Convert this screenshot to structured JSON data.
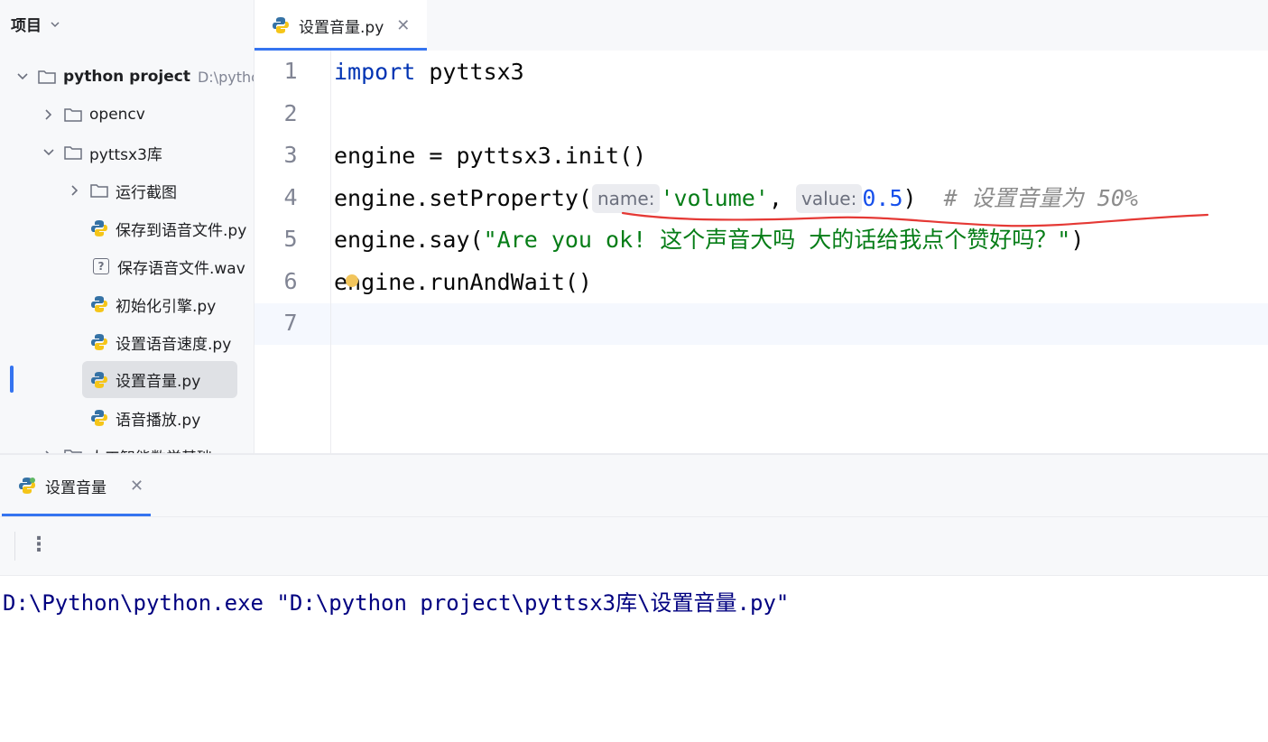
{
  "sidebar": {
    "header_label": "项目",
    "tree": {
      "root_name": "python project",
      "root_path": "D:\\python",
      "items": [
        {
          "label": "opencv"
        },
        {
          "label": "pyttsx3库"
        },
        {
          "label": "运行截图"
        },
        {
          "label": "保存到语音文件.py"
        },
        {
          "label": "保存语音文件.wav"
        },
        {
          "label": "初始化引擎.py"
        },
        {
          "label": "设置语音速度.py"
        },
        {
          "label": "设置音量.py"
        },
        {
          "label": "语音播放.py"
        },
        {
          "label": "人工智能数学基础"
        }
      ]
    }
  },
  "editor": {
    "tab_label": "设置音量.py",
    "line_numbers": [
      "1",
      "2",
      "3",
      "4",
      "5",
      "6",
      "7"
    ],
    "code": {
      "l1_kw": "import",
      "l1_rest": " pyttsx3",
      "l3": "engine = pyttsx3.init()",
      "l4_prefix": "engine.setProperty(",
      "l4_hint_name": "name:",
      "l4_str": "'volume'",
      "l4_comma": ", ",
      "l4_hint_value": "value:",
      "l4_num": "0.5",
      "l4_close": ")",
      "l4_comment": "  # 设置音量为 50%",
      "l5_prefix": "engine.say(",
      "l5_str": "\"Are you ok! 这个声音大吗 大的话给我点个赞好吗？\"",
      "l5_close": ")",
      "l6": "engine.runAndWait()"
    },
    "annotation_color": "#e53935"
  },
  "run_panel": {
    "tab_label": "设置音量",
    "console_output": "D:\\Python\\python.exe \"D:\\python project\\pyttsx3库\\设置音量.py\""
  }
}
